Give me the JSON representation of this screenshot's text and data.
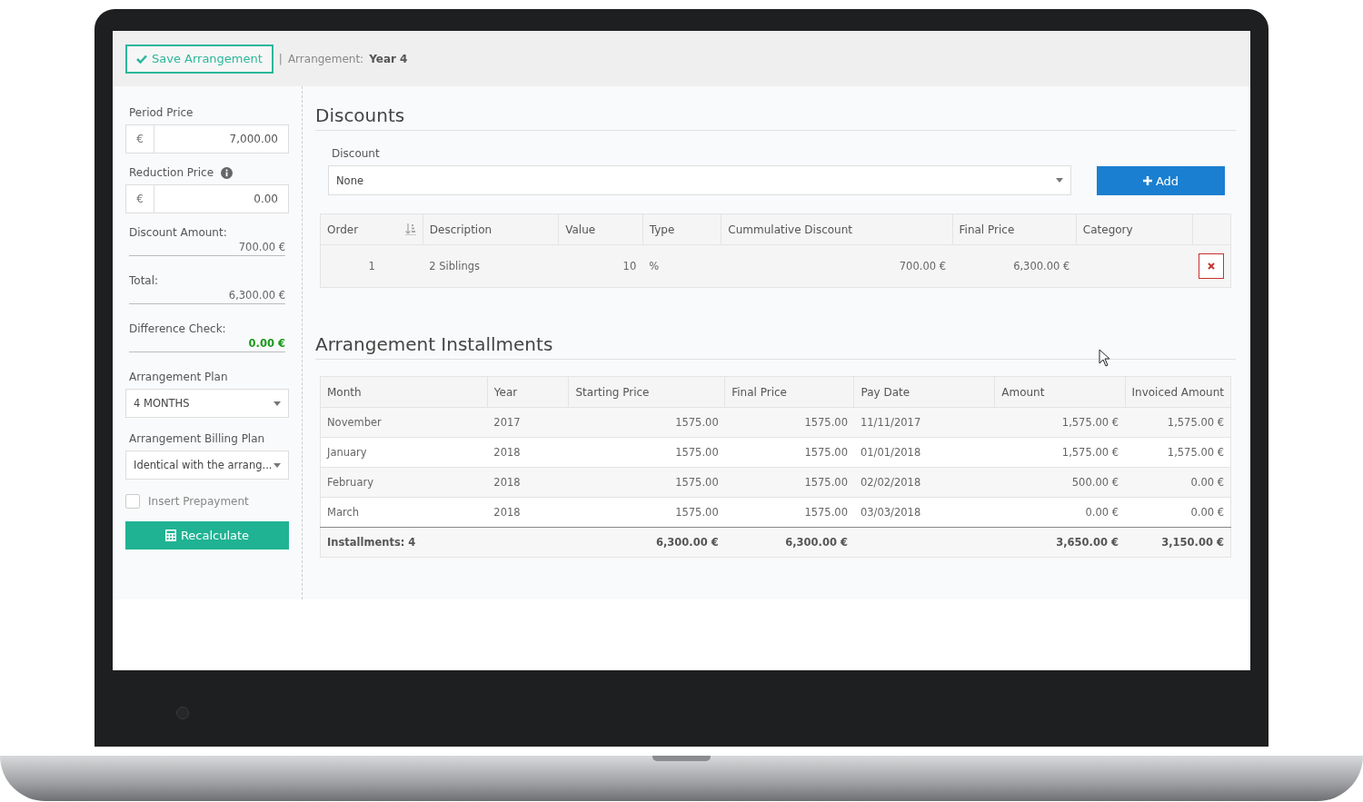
{
  "toolbar": {
    "save_button": "Save Arrangement",
    "separator": "|",
    "arrangement_label": "Arrangement:",
    "arrangement_name": "Year 4"
  },
  "sidebar": {
    "period_price": {
      "label": "Period Price",
      "currency": "€",
      "value": "7,000.00"
    },
    "reduction_price": {
      "label": "Reduction Price",
      "currency": "€",
      "value": "0.00"
    },
    "summary": [
      {
        "label": "Discount Amount:",
        "value": "700.00 €",
        "highlight": false
      },
      {
        "label": "Total:",
        "value": "6,300.00 €",
        "highlight": false
      },
      {
        "label": "Difference Check:",
        "value": "0.00 €",
        "highlight": true
      }
    ],
    "arrangement_plan": {
      "label": "Arrangement Plan",
      "value": "4 MONTHS"
    },
    "billing_plan": {
      "label": "Arrangement Billing Plan",
      "value": "Identical with the arrang..."
    },
    "prepayment": {
      "label": "Insert Prepayment",
      "checked": false
    },
    "recalculate_button": "Recalculate"
  },
  "discounts": {
    "title": "Discounts",
    "field_label": "Discount",
    "field_value": "None",
    "add_button": "Add",
    "columns": [
      "Order",
      "Description",
      "Value",
      "Type",
      "Cummulative Discount",
      "Final Price",
      "Category"
    ],
    "rows": [
      [
        "1",
        "2 Siblings",
        "10",
        "%",
        "700.00 €",
        "6,300.00 €"
      ]
    ]
  },
  "installments": {
    "title": "Arrangement Installments",
    "columns": [
      "Month",
      "Year",
      "Starting Price",
      "Final Price",
      "Pay Date",
      "Amount",
      "Invoiced Amount"
    ],
    "rows": [
      [
        "November",
        "2017",
        "1575.00",
        "1575.00",
        "11/11/2017",
        "1,575.00 €",
        "1,575.00 €"
      ],
      [
        "January",
        "2018",
        "1575.00",
        "1575.00",
        "01/01/2018",
        "1,575.00 €",
        "1,575.00 €"
      ],
      [
        "February",
        "2018",
        "1575.00",
        "1575.00",
        "02/02/2018",
        "500.00 €",
        "0.00 €"
      ],
      [
        "March",
        "2018",
        "1575.00",
        "1575.00",
        "03/03/2018",
        "0.00 €",
        "0.00 €"
      ]
    ],
    "footer": {
      "count": "Installments: 4",
      "starting_price": "6,300.00 €",
      "final_price": "6,300.00 €",
      "amount": "3,650.00 €",
      "invoiced_amount": "3,150.00 €"
    }
  }
}
